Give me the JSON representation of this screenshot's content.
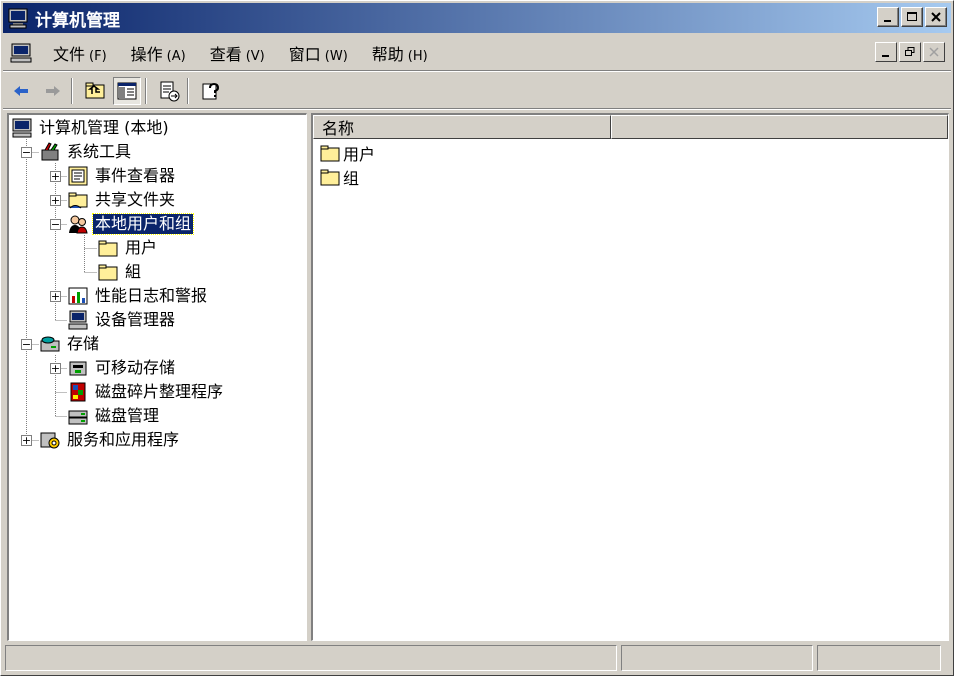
{
  "window": {
    "title": "计算机管理"
  },
  "menu": {
    "items": [
      {
        "label": "文件",
        "accel": "(F)"
      },
      {
        "label": "操作",
        "accel": "(A)"
      },
      {
        "label": "查看",
        "accel": "(V)"
      },
      {
        "label": "窗口",
        "accel": "(W)"
      },
      {
        "label": "帮助",
        "accel": "(H)"
      }
    ]
  },
  "tree": {
    "root": "计算机管理 (本地)",
    "system_tools": "系统工具",
    "event_viewer": "事件查看器",
    "shared_folders": "共享文件夹",
    "local_users_groups": "本地用户和组",
    "users": "用户",
    "groups": "組",
    "perf_logs": "性能日志和警报",
    "device_manager": "设备管理器",
    "storage": "存储",
    "removable_storage": "可移动存储",
    "defrag": "磁盘碎片整理程序",
    "disk_mgmt": "磁盘管理",
    "services_apps": "服务和应用程序"
  },
  "list": {
    "columns": [
      "名称",
      ""
    ],
    "rows": [
      "用户",
      "组"
    ]
  },
  "icons": {
    "app": "computer-icon",
    "back": "back-arrow-icon",
    "forward": "forward-arrow-icon",
    "up": "up-folder-icon",
    "show_tree": "show-tree-icon",
    "export": "export-list-icon",
    "help": "help-icon"
  },
  "colors": {
    "title_start": "#0a246a",
    "title_end": "#a6caf0",
    "selection": "#0a246a",
    "chrome": "#d4d0c8"
  }
}
